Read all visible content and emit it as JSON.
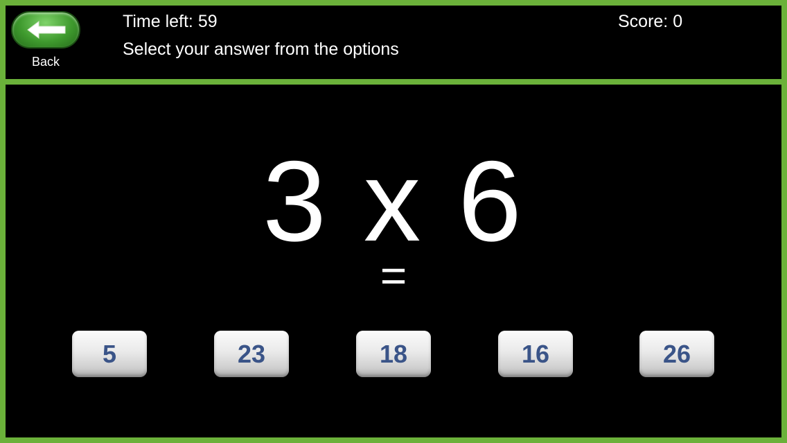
{
  "header": {
    "back_label": "Back",
    "time_left": "Time left: 59",
    "instruction": "Select your answer from the options",
    "score": "Score: 0"
  },
  "question": {
    "expression": "3 x 6",
    "equals": "="
  },
  "answers": [
    {
      "label": "5"
    },
    {
      "label": "23"
    },
    {
      "label": "18"
    },
    {
      "label": "16"
    },
    {
      "label": "26"
    }
  ],
  "colors": {
    "frame": "#6bb13a",
    "background": "#000000",
    "answer_text": "#3a5488"
  },
  "icons": {
    "back": "left-arrow-icon"
  }
}
